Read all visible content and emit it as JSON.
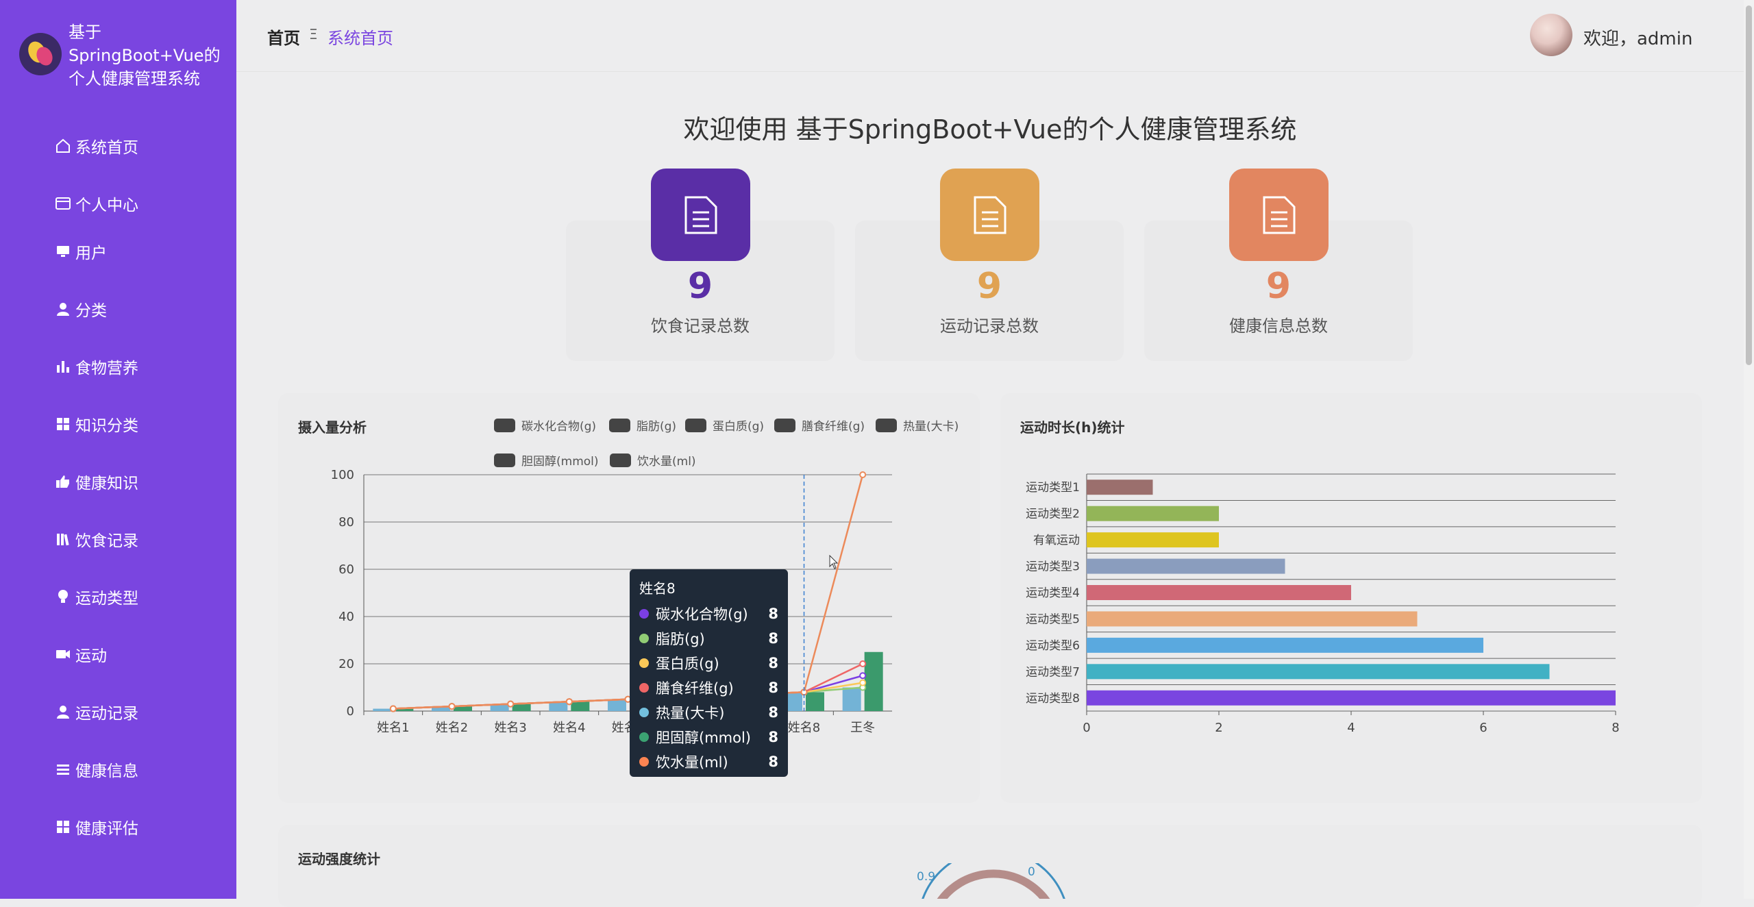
{
  "app": {
    "title": "基于SpringBoot+Vue的个人健康管理系统",
    "brand_color": "#7a45e0"
  },
  "sidebar": {
    "items": [
      {
        "label": "系统首页",
        "icon": "home-icon"
      },
      {
        "label": "个人中心",
        "icon": "id-card-icon"
      },
      {
        "label": "用户",
        "icon": "monitor-icon"
      },
      {
        "label": "分类",
        "icon": "user-icon"
      },
      {
        "label": "食物营养",
        "icon": "bar-chart-icon"
      },
      {
        "label": "知识分类",
        "icon": "grid-icon"
      },
      {
        "label": "健康知识",
        "icon": "thumbs-up-icon"
      },
      {
        "label": "饮食记录",
        "icon": "books-icon"
      },
      {
        "label": "运动类型",
        "icon": "lightbulb-icon"
      },
      {
        "label": "运动",
        "icon": "camera-icon"
      },
      {
        "label": "运动记录",
        "icon": "user-icon"
      },
      {
        "label": "健康信息",
        "icon": "list-icon"
      },
      {
        "label": "健康评估",
        "icon": "grid-icon"
      }
    ]
  },
  "header": {
    "breadcrumb_home": "首页",
    "breadcrumb_sep": "Ξ",
    "breadcrumb_current": "系统首页",
    "welcome": "欢迎，admin"
  },
  "main": {
    "heading": "欢迎使用 基于SpringBoot+Vue的个人健康管理系统",
    "stats": [
      {
        "value": "9",
        "label": "饮食记录总数",
        "color": "#5a2ea6",
        "icon": "document-icon"
      },
      {
        "value": "9",
        "label": "运动记录总数",
        "color": "#e0a252",
        "icon": "document-icon"
      },
      {
        "value": "9",
        "label": "健康信息总数",
        "color": "#e28660",
        "icon": "document-icon"
      }
    ]
  },
  "panels": {
    "intake_title": "摄入量分析",
    "duration_title": "运动时长(h)统计",
    "intensity_title": "运动强度统计"
  },
  "tooltip": {
    "title": "姓名8",
    "rows": [
      {
        "name": "碳水化合物(g)",
        "value": "8",
        "color": "#7b3fe4"
      },
      {
        "name": "脂肪(g)",
        "value": "8",
        "color": "#91cc75"
      },
      {
        "name": "蛋白质(g)",
        "value": "8",
        "color": "#fac858"
      },
      {
        "name": "膳食纤维(g)",
        "value": "8",
        "color": "#ee6666"
      },
      {
        "name": "热量(大卡)",
        "value": "8",
        "color": "#73c0de"
      },
      {
        "name": "胆固醇(mmol)",
        "value": "8",
        "color": "#3ba272"
      },
      {
        "name": "饮水量(ml)",
        "value": "8",
        "color": "#fc8452"
      }
    ]
  },
  "gauge_labels": [
    "0.9",
    "0"
  ],
  "chart_data": [
    {
      "type": "line",
      "title": "摄入量分析",
      "categories": [
        "姓名1",
        "姓名2",
        "姓名3",
        "姓名4",
        "姓名5",
        "姓名6",
        "姓名7",
        "姓名8",
        "王冬"
      ],
      "ylim": [
        0,
        100
      ],
      "yticks": [
        0,
        20,
        40,
        60,
        80,
        100
      ],
      "grid": true,
      "legend_position": "top-right",
      "series": [
        {
          "name": "碳水化合物(g)",
          "kind": "line",
          "color": "#7b3fe4",
          "values": [
            1,
            2,
            3,
            4,
            5,
            6,
            7,
            8,
            15
          ]
        },
        {
          "name": "脂肪(g)",
          "kind": "line",
          "color": "#91cc75",
          "values": [
            1,
            2,
            3,
            4,
            5,
            6,
            7,
            8,
            10
          ]
        },
        {
          "name": "蛋白质(g)",
          "kind": "line",
          "color": "#fac858",
          "values": [
            1,
            2,
            3,
            4,
            5,
            6,
            7,
            8,
            12
          ]
        },
        {
          "name": "膳食纤维(g)",
          "kind": "line",
          "color": "#ee6666",
          "values": [
            1,
            2,
            3,
            4,
            5,
            6,
            7,
            8,
            20
          ]
        },
        {
          "name": "热量(大卡)",
          "kind": "bar",
          "color": "#73b3d6",
          "values": [
            1,
            2,
            3,
            4,
            5,
            6,
            7,
            8,
            10
          ]
        },
        {
          "name": "胆固醇(mmol)",
          "kind": "bar",
          "color": "#3b9a6c",
          "values": [
            1,
            2,
            3,
            4,
            5,
            6,
            7,
            8,
            25
          ]
        },
        {
          "name": "饮水量(ml)",
          "kind": "line",
          "color": "#ec8a5a",
          "values": [
            1,
            2,
            3,
            4,
            5,
            6,
            7,
            8,
            100
          ]
        }
      ]
    },
    {
      "type": "bar",
      "orientation": "horizontal",
      "title": "运动时长(h)统计",
      "categories": [
        "运动类型1",
        "运动类型2",
        "有氧运动",
        "运动类型3",
        "运动类型4",
        "运动类型5",
        "运动类型6",
        "运动类型7",
        "运动类型8"
      ],
      "values": [
        1,
        2,
        2,
        3,
        4,
        5,
        6,
        7,
        8
      ],
      "colors": [
        "#9b6f6d",
        "#93b558",
        "#dec51f",
        "#8a9dbe",
        "#d06876",
        "#eaaa7a",
        "#5aa9df",
        "#41b1c4",
        "#7a45e0"
      ],
      "xlim": [
        0,
        8
      ],
      "xticks": [
        0,
        2,
        4,
        6,
        8
      ]
    }
  ]
}
